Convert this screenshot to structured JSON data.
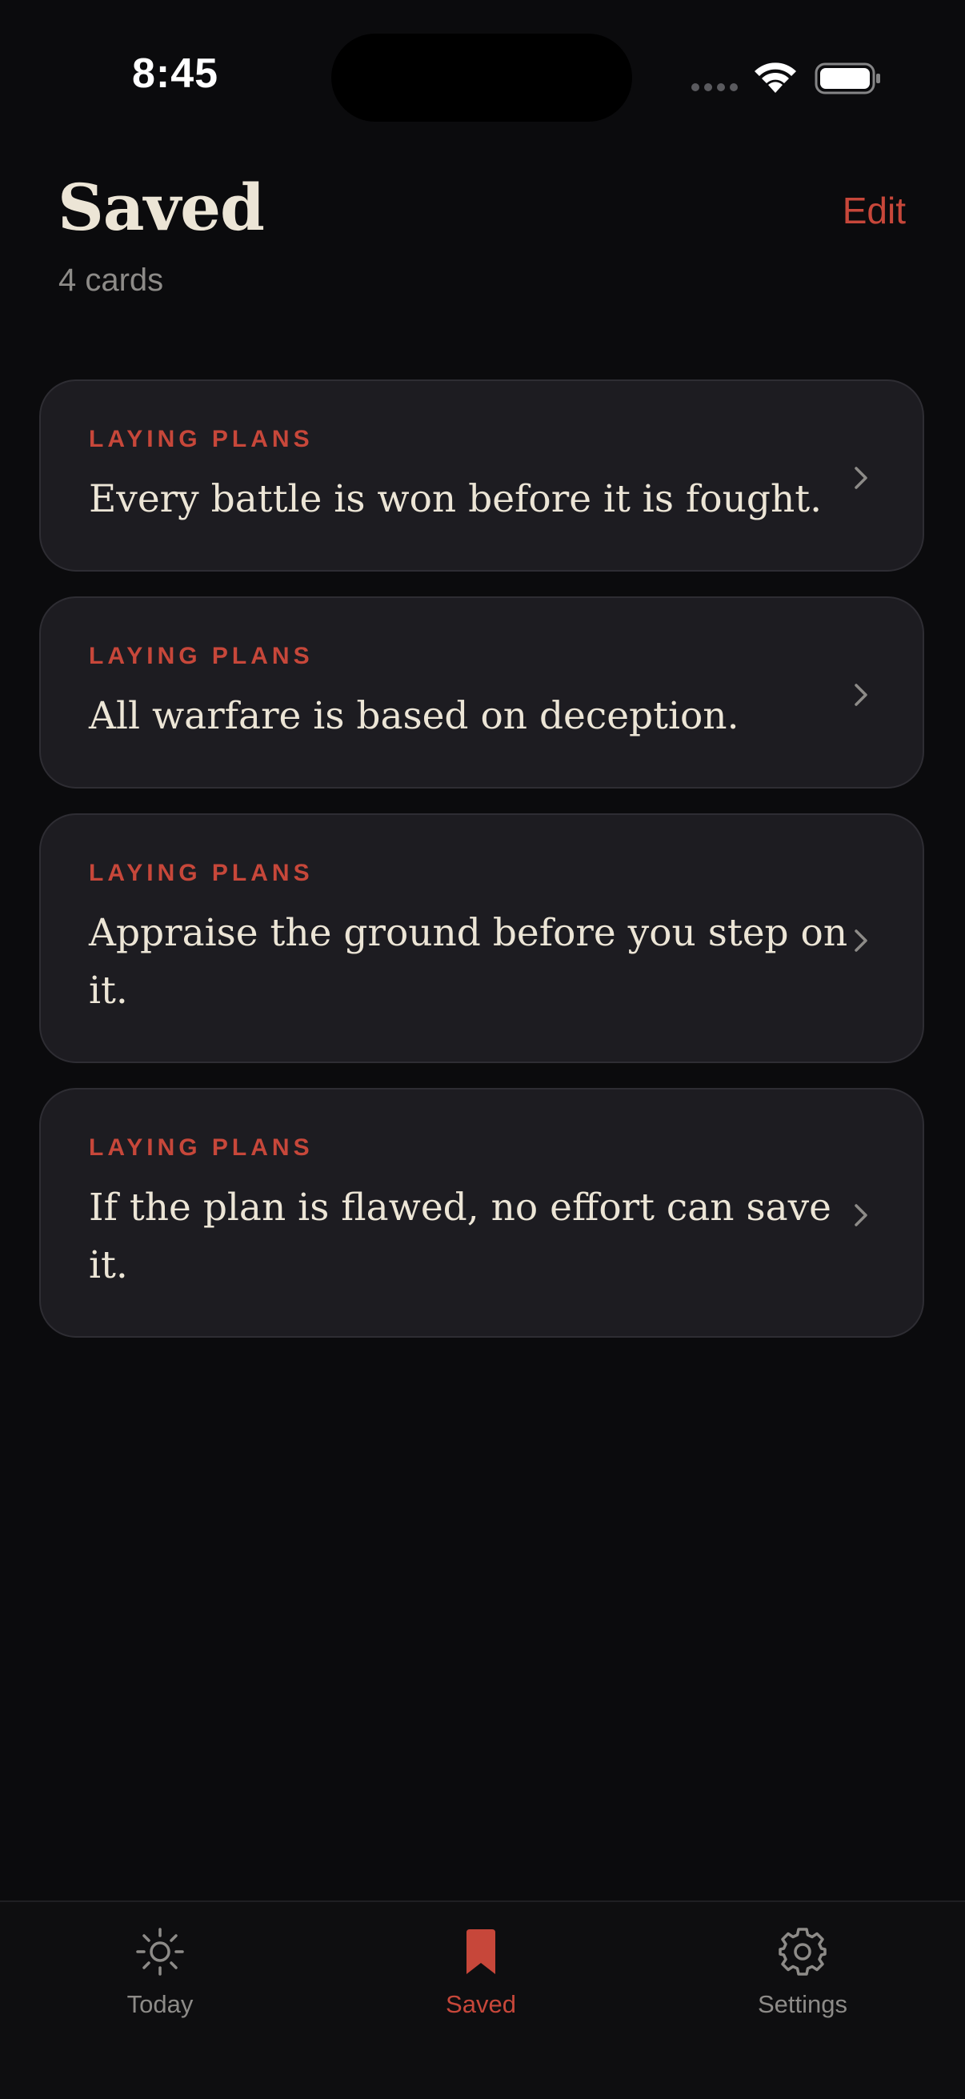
{
  "status_bar": {
    "time": "8:45"
  },
  "header": {
    "title": "Saved",
    "subtitle": "4 cards",
    "edit_label": "Edit"
  },
  "cards": [
    {
      "category": "LAYING PLANS",
      "quote": "Every battle is won before it is fought."
    },
    {
      "category": "LAYING PLANS",
      "quote": "All warfare is based on deception."
    },
    {
      "category": "LAYING PLANS",
      "quote": "Appraise the ground before you step on it."
    },
    {
      "category": "LAYING PLANS",
      "quote": "If the plan is flawed, no effort can save it."
    }
  ],
  "tab_bar": {
    "tabs": [
      {
        "label": "Today",
        "icon": "sun-icon",
        "active": false
      },
      {
        "label": "Saved",
        "icon": "bookmark-icon",
        "active": true
      },
      {
        "label": "Settings",
        "icon": "gear-icon",
        "active": false
      }
    ]
  },
  "colors": {
    "background": "#0b0b0d",
    "card_background": "#1d1c21",
    "accent": "#c7473a",
    "text_primary": "#ece5d6",
    "text_secondary": "#8d8b88"
  }
}
